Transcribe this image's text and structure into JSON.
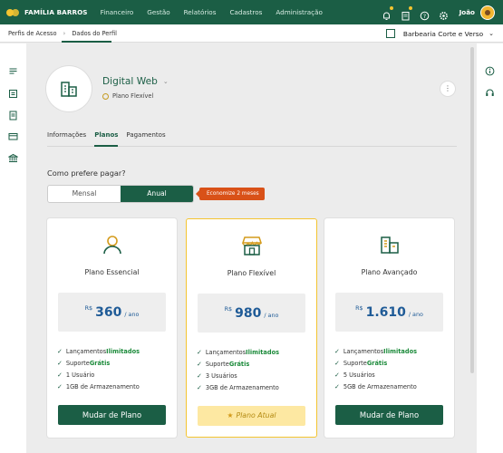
{
  "brand": "FAMÍLIA BARROS",
  "menu": [
    "Financeiro",
    "Gestão",
    "Relatórios",
    "Cadastros",
    "Administração"
  ],
  "user": "João",
  "breadcrumb": [
    "Perfis de Acesso",
    "Dados do Perfil"
  ],
  "company": "Barbearia Corte e Verso",
  "profile": {
    "name": "Digital Web",
    "plan": "Plano Flexível"
  },
  "tabs": [
    "Informações",
    "Planos",
    "Pagamentos"
  ],
  "pay_question": "Como prefere pagar?",
  "toggle": {
    "monthly": "Mensal",
    "yearly": "Anual",
    "badge": "Economize 2 meses"
  },
  "plans": [
    {
      "title": "Plano Essencial",
      "currency": "R$",
      "price": "360",
      "period": "/ ano",
      "features": [
        {
          "pre": "Lançamentos ",
          "hi": "Ilimitados",
          "post": ""
        },
        {
          "pre": "Suporte ",
          "hi": "Grátis",
          "post": ""
        },
        {
          "pre": "1 Usuário",
          "hi": "",
          "post": ""
        },
        {
          "pre": "1GB de Armazenamento",
          "hi": "",
          "post": ""
        }
      ],
      "button": "Mudar de Plano"
    },
    {
      "title": "Plano Flexível",
      "currency": "R$",
      "price": "980",
      "period": "/ ano",
      "features": [
        {
          "pre": "Lançamentos ",
          "hi": "Ilimitados",
          "post": ""
        },
        {
          "pre": "Suporte ",
          "hi": "Grátis",
          "post": ""
        },
        {
          "pre": "3 Usuários",
          "hi": "",
          "post": ""
        },
        {
          "pre": "3GB de Armazenamento",
          "hi": "",
          "post": ""
        }
      ],
      "button": "Plano Atual"
    },
    {
      "title": "Plano Avançado",
      "currency": "R$",
      "price": "1.610",
      "period": "/ ano",
      "features": [
        {
          "pre": "Lançamentos ",
          "hi": "Ilimitados",
          "post": ""
        },
        {
          "pre": "Suporte ",
          "hi": "Grátis",
          "post": ""
        },
        {
          "pre": "5 Usuários",
          "hi": "",
          "post": ""
        },
        {
          "pre": "5GB de Armazenamento",
          "hi": "",
          "post": ""
        }
      ],
      "button": "Mudar de Plano"
    }
  ],
  "colors": {
    "primary": "#1b5e45",
    "accent": "#f4c430",
    "badge": "#d95118",
    "price": "#1f5b97"
  }
}
